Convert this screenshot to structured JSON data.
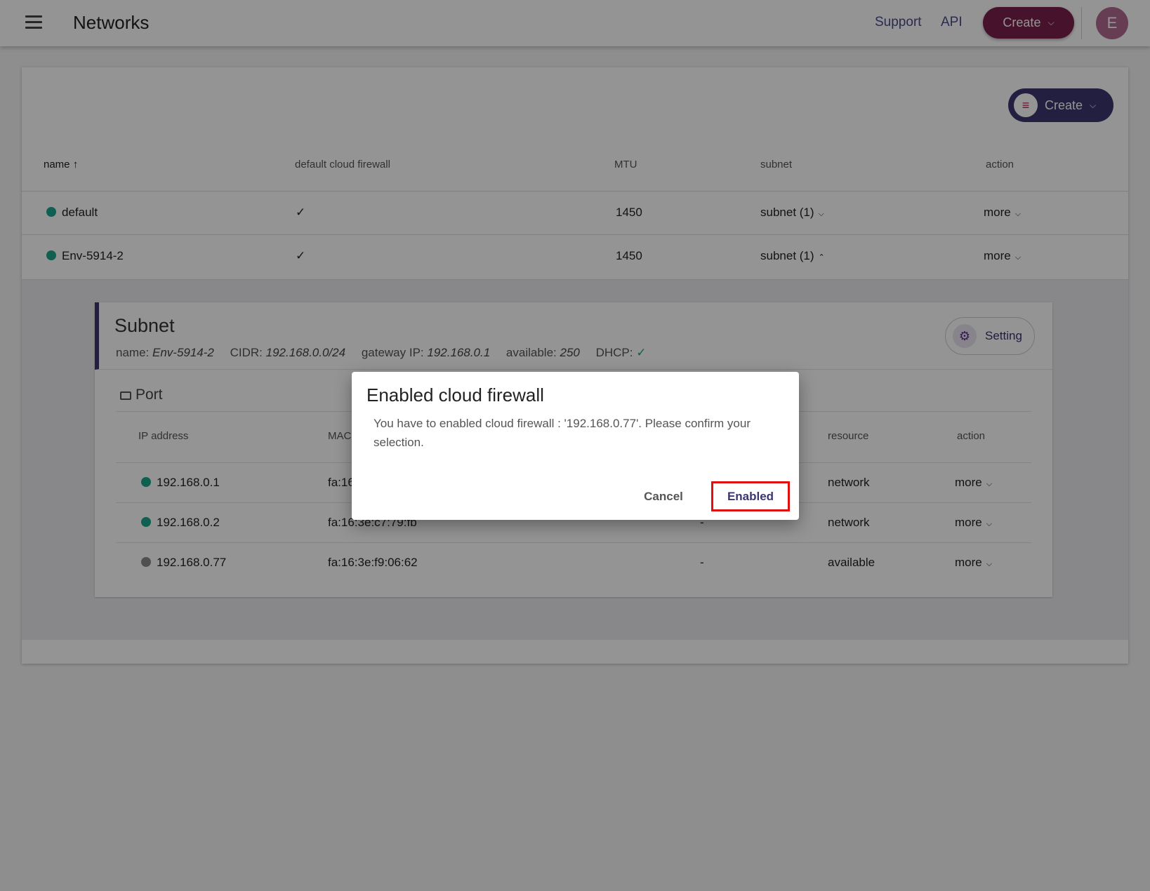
{
  "header": {
    "menu_icon": "hamburger-menu-icon",
    "title": "Networks",
    "links": [
      "Support",
      "API"
    ],
    "create_label": "Create",
    "avatar_initial": "E"
  },
  "toolbar": {
    "create_label": "Create",
    "create_icon": "playlist-add-icon"
  },
  "table": {
    "columns": [
      "name",
      "default cloud firewall",
      "MTU",
      "subnet",
      "action"
    ],
    "sort_icon": "arrow-up-icon",
    "rows": [
      {
        "name": "default",
        "status_color": "#1aa58a",
        "firewall": "✓",
        "mtu": "1450",
        "subnet": "subnet (1)",
        "subnet_icon": "chevron-down-icon",
        "action": "more"
      },
      {
        "name": "Env-5914-2",
        "status_color": "#1aa58a",
        "firewall": "✓",
        "mtu": "1450",
        "subnet": "subnet (1)",
        "subnet_icon": "chevron-up-icon",
        "action": "more"
      }
    ]
  },
  "subnet": {
    "title": "Subnet",
    "name_label": "name:",
    "name_value": "Env-5914-2",
    "cidr_label": "CIDR:",
    "cidr_value": "192.168.0.0/24",
    "gateway_label": "gateway IP:",
    "gateway_value": "192.168.0.1",
    "available_label": "available:",
    "available_value": "250",
    "dhcp_label": "DHCP:",
    "dhcp_value": "✓",
    "setting_label": "Setting",
    "setting_icon": "gear-icon"
  },
  "port": {
    "title": "Port",
    "icon": "monitor-icon",
    "columns": [
      "IP address",
      "MAC",
      "resource",
      "action"
    ],
    "rows": [
      {
        "ip": "192.168.0.1",
        "status": "active",
        "mac": "fa:16",
        "device": "",
        "resource": "network",
        "action": "more"
      },
      {
        "ip": "192.168.0.2",
        "status": "active",
        "mac": "fa:16:3e:c7:79:fb",
        "device": "-",
        "resource": "network",
        "action": "more"
      },
      {
        "ip": "192.168.0.77",
        "status": "inactive",
        "mac": "fa:16:3e:f9:06:62",
        "device": "-",
        "resource": "available",
        "action": "more"
      }
    ]
  },
  "dialog": {
    "title": "Enabled cloud firewall",
    "body": "You have to enabled cloud firewall : '192.168.0.77'. Please confirm your selection.",
    "cancel_label": "Cancel",
    "confirm_label": "Enabled"
  }
}
